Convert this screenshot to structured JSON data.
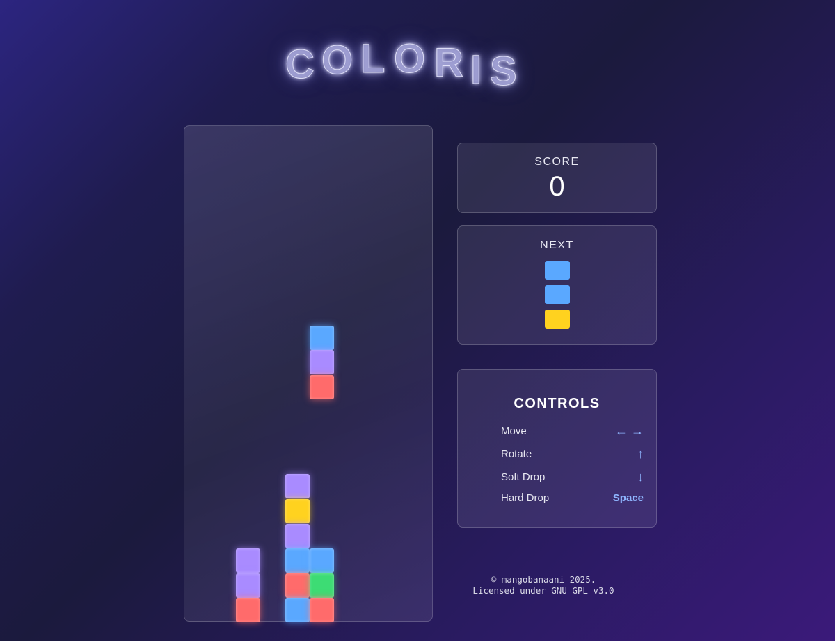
{
  "title": {
    "letters": [
      "C",
      "O",
      "L",
      "O",
      "R",
      "I",
      "S"
    ]
  },
  "colors": {
    "blue": "#5aa8ff",
    "purple": "#a98bff",
    "red": "#ff6b6b",
    "yellow": "#ffd21f",
    "green": "#3ddc74"
  },
  "board": {
    "columns": 10,
    "rows": 20,
    "falling_piece": [
      {
        "col": 5,
        "row": 8,
        "color": "blue"
      },
      {
        "col": 5,
        "row": 9,
        "color": "purple"
      },
      {
        "col": 5,
        "row": 10,
        "color": "red"
      }
    ],
    "locked_blocks": [
      {
        "col": 4,
        "row": 14,
        "color": "purple"
      },
      {
        "col": 4,
        "row": 15,
        "color": "yellow"
      },
      {
        "col": 4,
        "row": 16,
        "color": "purple"
      },
      {
        "col": 2,
        "row": 17,
        "color": "purple"
      },
      {
        "col": 4,
        "row": 17,
        "color": "blue"
      },
      {
        "col": 5,
        "row": 17,
        "color": "blue"
      },
      {
        "col": 2,
        "row": 18,
        "color": "purple"
      },
      {
        "col": 4,
        "row": 18,
        "color": "red"
      },
      {
        "col": 5,
        "row": 18,
        "color": "green"
      },
      {
        "col": 2,
        "row": 19,
        "color": "red"
      },
      {
        "col": 4,
        "row": 19,
        "color": "blue"
      },
      {
        "col": 5,
        "row": 19,
        "color": "red"
      }
    ]
  },
  "score": {
    "label": "SCORE",
    "value": "0"
  },
  "next": {
    "label": "NEXT",
    "blocks": [
      "blue",
      "blue",
      "yellow"
    ]
  },
  "controls": {
    "title": "CONTROLS",
    "items": [
      {
        "name": "Move",
        "key": "← →"
      },
      {
        "name": "Rotate",
        "key": "↑"
      },
      {
        "name": "Soft Drop",
        "key": "↓"
      },
      {
        "name": "Hard Drop",
        "key": "Space"
      }
    ]
  },
  "footer": {
    "line1": "© mangobanaani 2025.",
    "line2": "Licensed under GNU GPL v3.0"
  }
}
